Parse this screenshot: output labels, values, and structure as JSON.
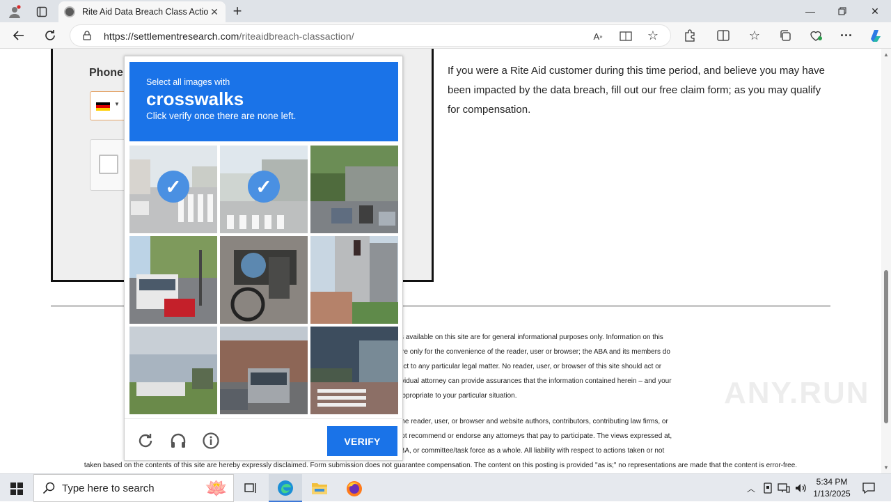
{
  "browser": {
    "tab_title": "Rite Aid Data Breach Class Action",
    "url_host": "https://settlementresearch.com",
    "url_path": "/riteaidbreach-classaction/"
  },
  "page": {
    "phone_label": "Phone",
    "paragraph": "If you were a Rite Aid customer during this time period, and believe you may have been impacted by the data breach, fill out our free claim form; as you may qualify for compensation.",
    "fine_print_1": [
      "The information pro                                                                                              d, all information, content, and materials available on this site are for general informational purposes only. Information on this",
      "website may not con                                                                                             o other third-party websites. Such links are only for the convenience of the reader, user or browser; the ABA and its members do",
      "not recommend or                                                                                                 their attorney to obtain advice with respect to any particular legal matter. No reader, user, or browser of this site should act or",
      "refrain from acting on                                                                                           n the relevant jurisdiction. Only your individual attorney can provide assurances that the information contained herein – and your",
      "                                                                                                                 plicable or appropriate to your particular situation."
    ],
    "fine_print_2": [
      "Use of, and access to                                                                                            n attorney-client relationship between the reader, user, or browser and website authors, contributors, contributing law firms, or",
      "committee members                                                                                                not directly provide legal advice. We do not recommend or endorse any attorneys that pay to participate. The views expressed at,",
      "or through, this site                                                                                           ose of their respective employers, the ABA, or committee/task force as a whole. All liability with respect to actions taken or not",
      "taken based on the contents of this site are hereby expressly disclaimed. Form submission does not guarantee compensation. The content on this posting is provided \"as is;\" no representations are made that the content is error-free."
    ]
  },
  "captcha": {
    "instruction": "Select all images with",
    "target": "crosswalks",
    "hint": "Click verify once there are none left.",
    "verify_label": "VERIFY",
    "tiles": [
      {
        "selected": true,
        "scene": "street with crosswalk"
      },
      {
        "selected": true,
        "scene": "street with crosswalk"
      },
      {
        "selected": false,
        "scene": "traffic with motorbikes"
      },
      {
        "selected": false,
        "scene": "bus and red car"
      },
      {
        "selected": false,
        "scene": "motorbike with cargo"
      },
      {
        "selected": false,
        "scene": "tall building and traffic light"
      },
      {
        "selected": false,
        "scene": "trees and bus under clouds"
      },
      {
        "selected": false,
        "scene": "bus on residential street"
      },
      {
        "selected": false,
        "scene": "crosswalk near building"
      }
    ]
  },
  "taskbar": {
    "search_placeholder": "Type here to search",
    "time": "5:34 PM",
    "date": "1/13/2025"
  },
  "watermark": "ANY.RUN",
  "colors": {
    "accent": "#1a73e8",
    "page_bg": "#ffffff",
    "form_bg": "#efefef"
  }
}
